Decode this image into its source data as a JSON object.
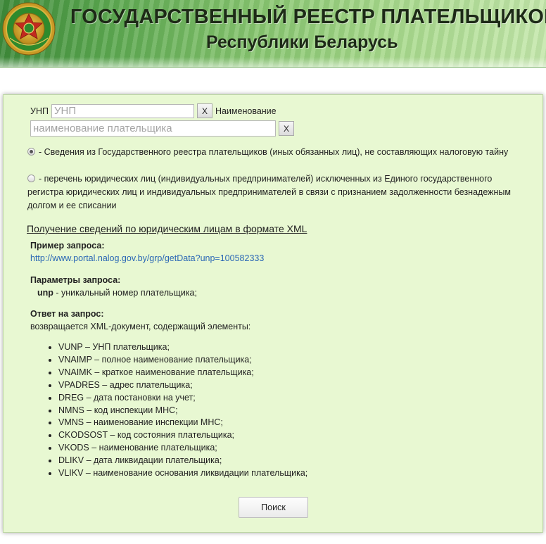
{
  "header": {
    "title": "ГОСУДАРСТВЕННЫЙ РЕЕСТР ПЛАТЕЛЬЩИКОВ",
    "subtitle": "Республики Беларусь"
  },
  "form": {
    "unp_label": "УНП",
    "unp_placeholder": "УНП",
    "unp_clear": "X",
    "name_label": "Наименование",
    "name_placeholder": "наименование плательщика",
    "name_clear": "X",
    "radio_1": "- Сведения из Государственного реестра плательщиков (иных обязанных лиц), не составляющих налоговую тайну",
    "radio_2": "- перечень юридических лиц (индивидуальных предпринимателей) исключенных из Единого государственного регистра юридических лиц и индивидуальных предпринимателей в связи с признанием задолженности безнадежным долгом и ее списании",
    "radio_1_checked": true
  },
  "xml_info": {
    "link": "Получение сведений по юридическим лицам в формате XML",
    "example_heading": "Пример запроса:",
    "example_url": "http://www.portal.nalog.gov.by/grp/getData?unp=100582333",
    "params_heading": "Параметры запроса:",
    "param_name": "unp",
    "param_desc": " - уникальный номер плательщика;",
    "response_heading": "Ответ на запрос:",
    "response_desc": "возвращается XML-документ, содержащий элементы:",
    "elements": [
      "VUNP – УНП плательщика;",
      "VNAIMP – полное наименование плательщика;",
      "VNAIMK – краткое наименование плательщика;",
      "VPADRES – адрес плательщика;",
      "DREG – дата постановки на учет;",
      "NMNS – код инспекции МНС;",
      "VMNS – наименование инспекции МНС;",
      "CKODSOST – код состояния плательщика;",
      "VKODS – наименование плательщика;",
      "DLIKV – дата ликвидации плательщика;",
      "VLIKV – наименование основания ликвидации плательщика;"
    ]
  },
  "search_button": "Поиск",
  "colors": {
    "panel_bg": "#e8f8d2",
    "link": "#2a67b5",
    "banner": "#5aa64f"
  },
  "icons": {
    "emblem": "tax-emblem-icon"
  }
}
